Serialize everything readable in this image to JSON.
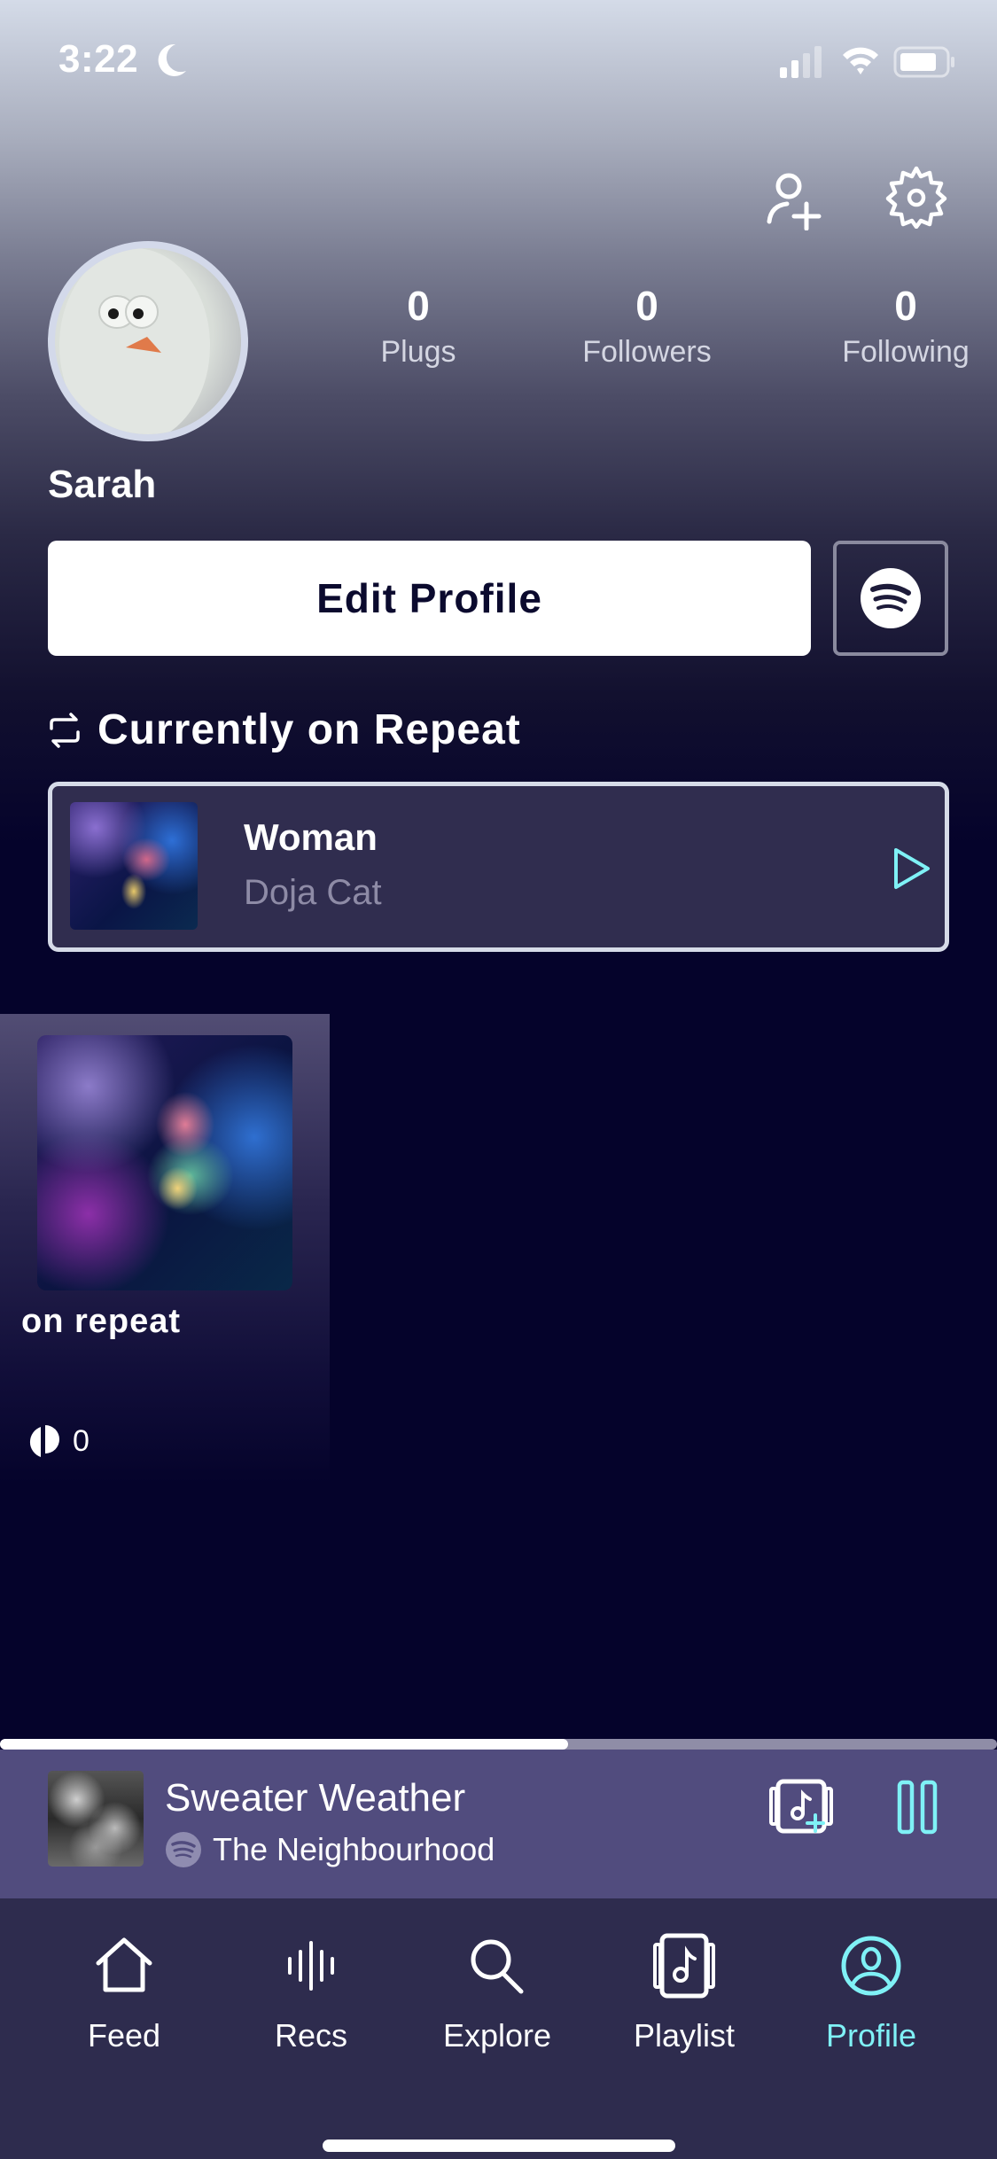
{
  "status_bar": {
    "time": "3:22",
    "icons": [
      "moon-icon",
      "signal-icon",
      "wifi-icon",
      "battery-icon"
    ]
  },
  "header": {
    "icons": [
      "add-user-icon",
      "settings-gear-icon"
    ]
  },
  "profile": {
    "username": "Sarah",
    "avatar": "egg-character-avatar",
    "stats": [
      {
        "value": "0",
        "label": "Plugs"
      },
      {
        "value": "0",
        "label": "Followers"
      },
      {
        "value": "0",
        "label": "Following"
      }
    ],
    "edit_button_label": "Edit Profile",
    "spotify_icon": "spotify-icon"
  },
  "currently_on_repeat": {
    "heading": "Currently on Repeat",
    "icon": "repeat-icon",
    "track": {
      "title": "Woman",
      "artist": "Doja Cat",
      "play_icon": "play-icon"
    }
  },
  "playlists": [
    {
      "name": "on repeat",
      "plug_count": "0",
      "plug_icon": "plug-icon"
    }
  ],
  "now_playing": {
    "title": "Sweater Weather",
    "artist": "The Neighbourhood",
    "source_icon": "spotify-icon",
    "progress_percent": 57,
    "add_to_playlist_icon": "add-to-playlist-icon",
    "pause_icon": "pause-icon"
  },
  "tab_bar": {
    "active": "Profile",
    "accent_color": "#7ff1f6",
    "tabs": [
      {
        "label": "Feed",
        "icon": "home-icon"
      },
      {
        "label": "Recs",
        "icon": "soundwave-icon"
      },
      {
        "label": "Explore",
        "icon": "search-icon"
      },
      {
        "label": "Playlist",
        "icon": "playlist-icon"
      },
      {
        "label": "Profile",
        "icon": "profile-icon"
      }
    ]
  },
  "colors": {
    "background": "#05032b",
    "card": "#302d4f",
    "mini_player": "#514c7e",
    "tab_bar": "#2e2c4e",
    "accent": "#7ff1f6"
  }
}
